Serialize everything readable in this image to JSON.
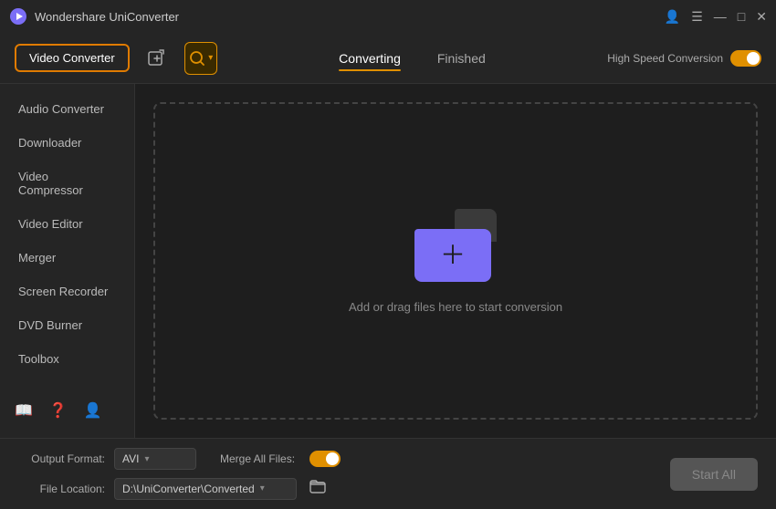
{
  "app": {
    "title": "Wondershare UniConverter",
    "icon": "🎬"
  },
  "title_bar": {
    "hamburger": "☰",
    "minimize": "—",
    "maximize": "□",
    "close": "✕"
  },
  "toolbar": {
    "video_converter_label": "Video Converter",
    "tab_converting": "Converting",
    "tab_finished": "Finished",
    "high_speed_label": "High Speed Conversion",
    "high_speed_on": true
  },
  "sidebar": {
    "items": [
      {
        "label": "Audio Converter",
        "active": false
      },
      {
        "label": "Downloader",
        "active": false
      },
      {
        "label": "Video Compressor",
        "active": false
      },
      {
        "label": "Video Editor",
        "active": false
      },
      {
        "label": "Merger",
        "active": false
      },
      {
        "label": "Screen Recorder",
        "active": false
      },
      {
        "label": "DVD Burner",
        "active": false
      },
      {
        "label": "Toolbox",
        "active": false
      }
    ],
    "bottom_icons": [
      "📖",
      "❓",
      "👤"
    ]
  },
  "drop_zone": {
    "text": "Add or drag files here to start conversion"
  },
  "bottom_bar": {
    "output_format_label": "Output Format:",
    "output_format_value": "AVI",
    "merge_label": "Merge All Files:",
    "merge_on": true,
    "file_location_label": "File Location:",
    "file_location_value": "D:\\UniConverter\\Converted",
    "start_all_label": "Start All"
  }
}
